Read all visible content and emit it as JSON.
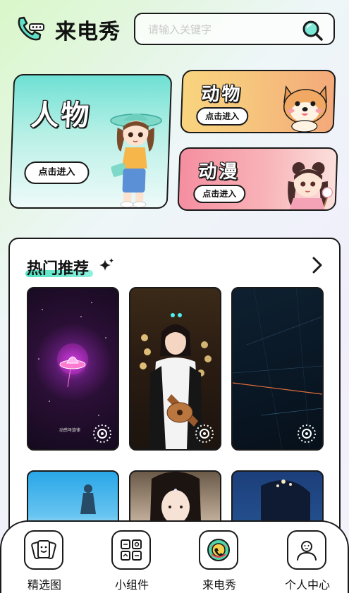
{
  "header": {
    "title": "来电秀",
    "search_placeholder": "请输入关键字"
  },
  "categories": [
    {
      "title": "人物",
      "button": "点击进入"
    },
    {
      "title": "动物",
      "button": "点击进入"
    },
    {
      "title": "动漫",
      "button": "点击进入"
    }
  ],
  "recommend": {
    "title": "热门推荐",
    "watermark": "动感与旋律"
  },
  "bottom_nav": [
    {
      "label": "精选图",
      "icon": "photo-cards-icon"
    },
    {
      "label": "小组件",
      "icon": "widgets-icon"
    },
    {
      "label": "来电秀",
      "icon": "call-show-icon"
    },
    {
      "label": "个人中心",
      "icon": "profile-icon"
    }
  ],
  "colors": {
    "accent_teal": "#4fe3c2",
    "person_card": "#6fe0d4",
    "animal_card": "#f6c77d",
    "anime_card": "#f58ea0",
    "outline": "#1a1a1a"
  }
}
